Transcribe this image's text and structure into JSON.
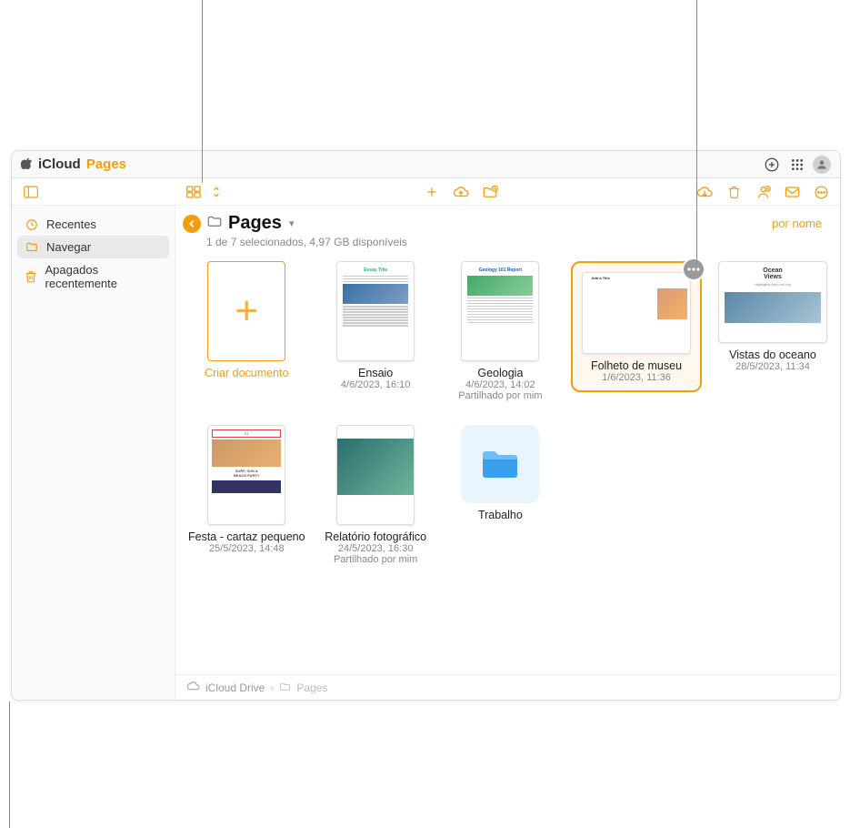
{
  "titlebar": {
    "brand_icloud": "iCloud",
    "brand_pages": "Pages"
  },
  "sidebar": {
    "items": [
      {
        "label": "Recentes"
      },
      {
        "label": "Navegar"
      },
      {
        "label": "Apagados recentemente"
      }
    ]
  },
  "location": {
    "title": "Pages",
    "status": "1 de 7 selecionados, 4,97 GB disponíveis",
    "sort_label": "por nome"
  },
  "create": {
    "label": "Criar documento"
  },
  "docs": [
    {
      "title": "Ensaio",
      "date": "4/6/2023, 16:10",
      "shared": ""
    },
    {
      "title": "Geologia",
      "date": "4/6/2023, 14:02",
      "shared": "Partilhado por mim"
    },
    {
      "title": "Folheto de museu",
      "date": "1/6/2023, 11:36",
      "shared": ""
    },
    {
      "title": "Vistas do oceano",
      "date": "28/5/2023, 11:34",
      "shared": ""
    },
    {
      "title": "Festa - cartaz pequeno",
      "date": "25/5/2023, 14:48",
      "shared": ""
    },
    {
      "title": "Relatório fotográfico",
      "date": "24/5/2023, 16:30",
      "shared": "Partilhado por mim"
    }
  ],
  "folders": [
    {
      "title": "Trabalho"
    }
  ],
  "breadcrumb": {
    "root": "iCloud Drive",
    "current": "Pages"
  }
}
